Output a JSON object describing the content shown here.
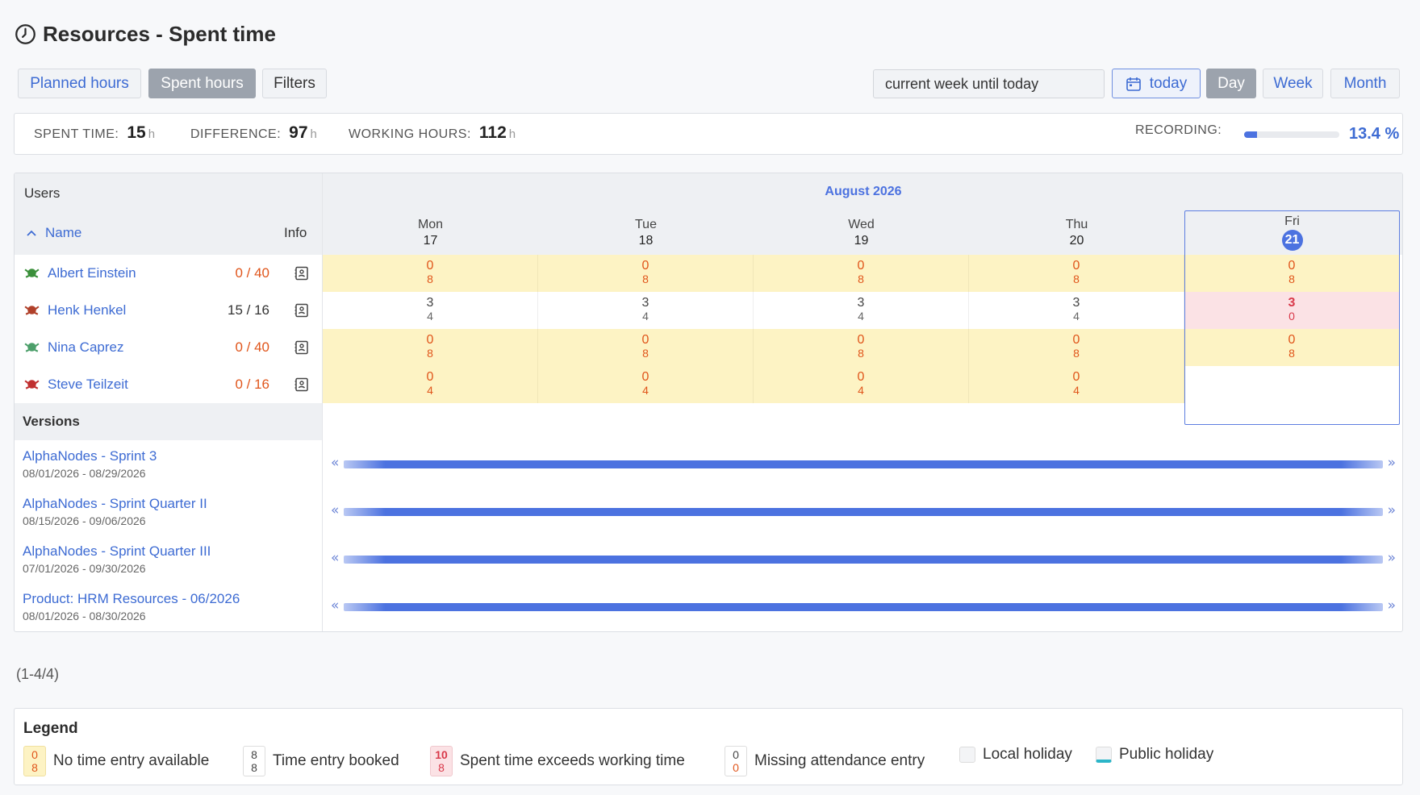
{
  "page": {
    "title": "Resources - Spent time"
  },
  "toolbar": {
    "planned_hours": "Planned hours",
    "spent_hours": "Spent hours",
    "filters": "Filters",
    "period_value": "current week until today",
    "today": "today",
    "day": "Day",
    "week": "Week",
    "month": "Month"
  },
  "summary": {
    "spent_label": "SPENT TIME:",
    "spent_value": "15",
    "difference_label": "DIFFERENCE:",
    "difference_value": "97",
    "working_label": "WORKING HOURS:",
    "working_value": "112",
    "unit": "h",
    "recording_label": "RECORDING:",
    "recording_value": "13.4 %",
    "recording_fraction": 0.134
  },
  "users": {
    "header": "Users",
    "name_col": "Name",
    "info_col": "Info",
    "rows": [
      {
        "name": "Albert Einstein",
        "hours": "0 / 40",
        "avatar_color": "#3a8f3a"
      },
      {
        "name": "Henk Henkel",
        "hours": "15 / 16",
        "avatar_color": "#b0402a"
      },
      {
        "name": "Nina Caprez",
        "hours": "0 / 40",
        "avatar_color": "#4c9f6a"
      },
      {
        "name": "Steve Teilzeit",
        "hours": "0 / 16",
        "avatar_color": "#c03030"
      }
    ]
  },
  "calendar": {
    "month": "August 2026",
    "days": [
      {
        "dow": "Mon",
        "num": "17"
      },
      {
        "dow": "Tue",
        "num": "18"
      },
      {
        "dow": "Wed",
        "num": "19"
      },
      {
        "dow": "Thu",
        "num": "20"
      },
      {
        "dow": "Fri",
        "num": "21"
      }
    ],
    "cells": [
      [
        {
          "a": "0",
          "b": "8"
        },
        {
          "a": "0",
          "b": "8"
        },
        {
          "a": "0",
          "b": "8"
        },
        {
          "a": "0",
          "b": "8"
        },
        {
          "a": "0",
          "b": "8"
        }
      ],
      [
        {
          "a": "3",
          "b": "4"
        },
        {
          "a": "3",
          "b": "4"
        },
        {
          "a": "3",
          "b": "4"
        },
        {
          "a": "3",
          "b": "4"
        },
        {
          "a": "3",
          "b": "0"
        }
      ],
      [
        {
          "a": "0",
          "b": "8"
        },
        {
          "a": "0",
          "b": "8"
        },
        {
          "a": "0",
          "b": "8"
        },
        {
          "a": "0",
          "b": "8"
        },
        {
          "a": "0",
          "b": "8"
        }
      ],
      [
        {
          "a": "0",
          "b": "4"
        },
        {
          "a": "0",
          "b": "4"
        },
        {
          "a": "0",
          "b": "4"
        },
        {
          "a": "0",
          "b": "4"
        },
        {
          "a": "",
          "b": ""
        }
      ]
    ]
  },
  "versions": {
    "header": "Versions",
    "rows": [
      {
        "name": "AlphaNodes - Sprint 3",
        "dates": "08/01/2026 - 08/29/2026"
      },
      {
        "name": "AlphaNodes - Sprint Quarter II",
        "dates": "08/15/2026 - 09/06/2026"
      },
      {
        "name": "AlphaNodes - Sprint Quarter III",
        "dates": "07/01/2026 - 09/30/2026"
      },
      {
        "name": "Product: HRM Resources - 06/2026",
        "dates": "08/01/2026 - 08/30/2026"
      }
    ]
  },
  "paging": "(1-4/4)",
  "legend": {
    "title": "Legend",
    "items": [
      {
        "a": "0",
        "b": "8",
        "label": "No time entry available"
      },
      {
        "a": "8",
        "b": "8",
        "label": "Time entry booked"
      },
      {
        "a": "10",
        "b": "8",
        "label": "Spent time exceeds working time"
      },
      {
        "a": "0",
        "b": "0",
        "label": "Missing attendance entry"
      },
      {
        "label": "Local holiday"
      },
      {
        "label": "Public holiday"
      }
    ]
  },
  "colors": {
    "accent": "#3d6bd3",
    "warning": "#e0551b",
    "over": "#d9394a",
    "no_entry_bg": "#fdf3c4"
  }
}
